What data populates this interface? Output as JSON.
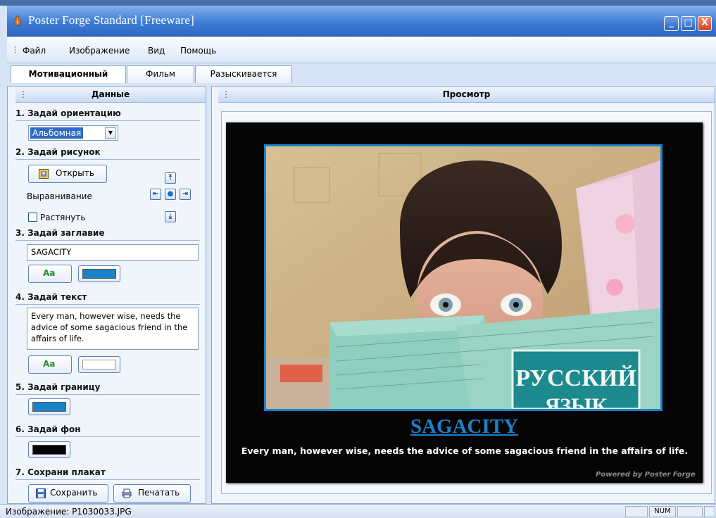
{
  "window": {
    "title": "Poster Forge Standard [Freeware]",
    "buttons": [
      "_",
      "□",
      "X"
    ]
  },
  "menu": {
    "items": [
      "Файл",
      "Изображение",
      "Вид",
      "Помощь"
    ]
  },
  "tabs": [
    {
      "label": "Мотивационный",
      "active": true
    },
    {
      "label": "Фильм",
      "active": false
    },
    {
      "label": "Разыскивается",
      "active": false
    }
  ],
  "left_panel": {
    "header": "Данные",
    "section1": {
      "title": "1. Задай ориентацию",
      "orientation_value": "Альбомная"
    },
    "section2": {
      "title": "2. Задай рисунок",
      "open_label": "Открыть",
      "align_label": "Выравнивание",
      "stretch_label": "Растянуть",
      "stretch_checked": false
    },
    "section3": {
      "title": "3. Задай заглавие",
      "title_value": "SAGACITY",
      "font_label": "Aa",
      "color": "#1a82c8"
    },
    "section4": {
      "title": "4. Задай текст",
      "text_value": "Every man, however wise, needs the advice of some sagacious friend in the affairs of life.",
      "font_label": "Aa",
      "color": "#ffffff"
    },
    "section5": {
      "title": "5. Задай границу",
      "color": "#1a82c8"
    },
    "section6": {
      "title": "6. Задай фон",
      "color": "#000000"
    },
    "section7": {
      "title": "7. Сохрани плакат",
      "save_label": "Сохранить",
      "print_label": "Печатать"
    }
  },
  "right_panel": {
    "header": "Просмотр",
    "poster": {
      "title": "SAGACITY",
      "text": "Every man, however wise, needs the advice of some sagacious friend in the affairs of life.",
      "credit": "Powered by Poster Forge",
      "book_text": "РУССКИЙ",
      "book_text2": "ЯЗЫК",
      "border_color": "#1a82c8",
      "background": "#000000"
    }
  },
  "status": {
    "text": "Изображение: P1030033.JPG",
    "num": "NUM"
  }
}
